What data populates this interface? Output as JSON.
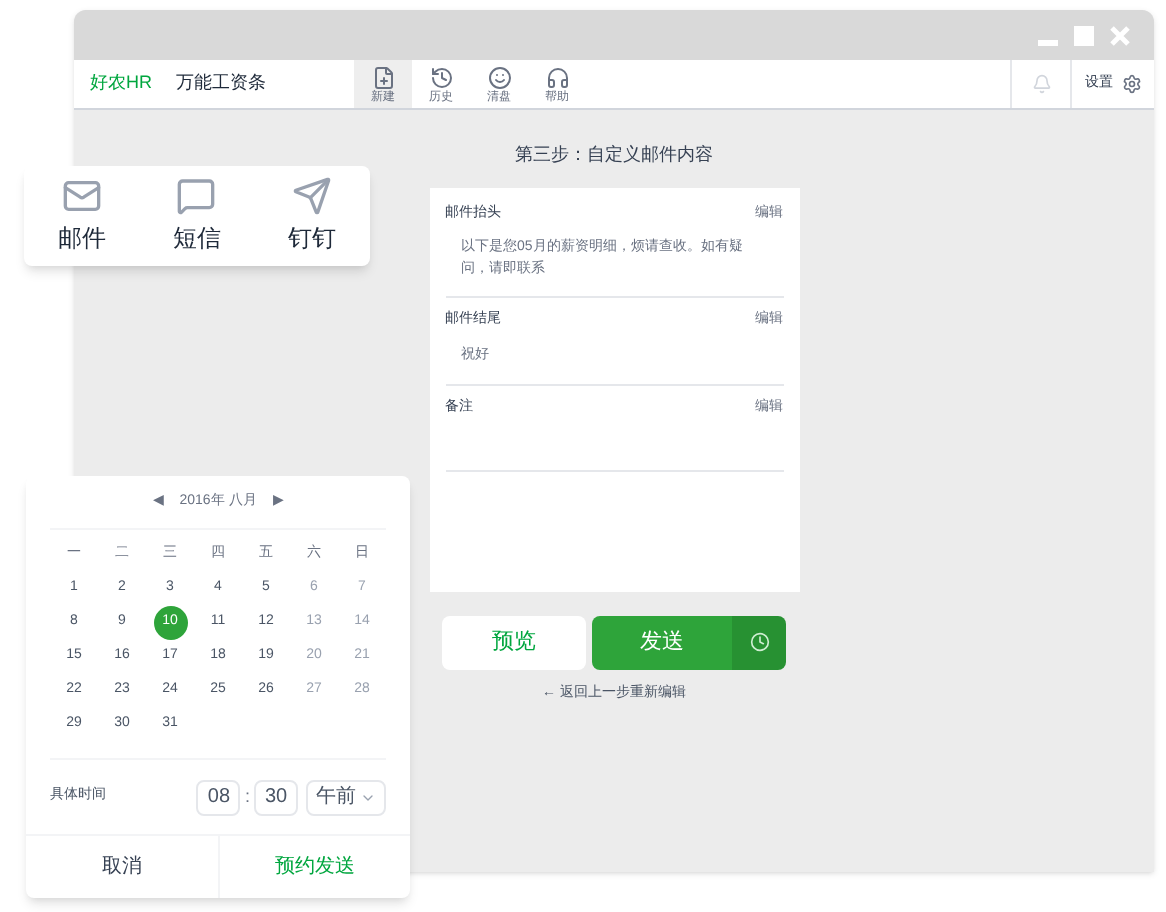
{
  "app": {
    "brand": "好农HR",
    "product": "万能工资条"
  },
  "toolbar": [
    {
      "label": "新建",
      "selected": true
    },
    {
      "label": "历史",
      "selected": false
    },
    {
      "label": "清盘",
      "selected": false
    },
    {
      "label": "帮助",
      "selected": false
    }
  ],
  "settings": {
    "label": "设置"
  },
  "step_title": "第三步：自定义邮件内容",
  "sections": [
    {
      "title": "邮件抬头",
      "action": "编辑",
      "body": "以下是您05月的薪资明细，烦请查收。如有疑问，请即联系"
    },
    {
      "title": "邮件结尾",
      "action": "编辑",
      "body": "祝好"
    },
    {
      "title": "备注",
      "action": "编辑"
    }
  ],
  "preview_button": "预览",
  "send_button": "发送",
  "back_link": "← 返回上一步重新编辑",
  "channels": [
    {
      "label": "邮件"
    },
    {
      "label": "短信"
    },
    {
      "label": "钉钉"
    }
  ],
  "calendar": {
    "prev": "◀",
    "month_label": "2016年 八月",
    "next": "▶",
    "weekdays": [
      "一",
      "二",
      "三",
      "四",
      "五",
      "六",
      "日"
    ],
    "days": [
      {
        "label": "1",
        "disabled": false,
        "selected": false
      },
      {
        "label": "2",
        "disabled": false,
        "selected": false
      },
      {
        "label": "3",
        "disabled": false,
        "selected": false
      },
      {
        "label": "4",
        "disabled": false,
        "selected": false
      },
      {
        "label": "5",
        "disabled": false,
        "selected": false
      },
      {
        "label": "6",
        "disabled": true,
        "selected": false
      },
      {
        "label": "7",
        "disabled": true,
        "selected": false
      },
      {
        "label": "8",
        "disabled": false,
        "selected": false
      },
      {
        "label": "9",
        "disabled": false,
        "selected": false
      },
      {
        "label": "10",
        "disabled": false,
        "selected": true
      },
      {
        "label": "11",
        "disabled": false,
        "selected": false
      },
      {
        "label": "12",
        "disabled": false,
        "selected": false
      },
      {
        "label": "13",
        "disabled": true,
        "selected": false
      },
      {
        "label": "14",
        "disabled": true,
        "selected": false
      },
      {
        "label": "15",
        "disabled": false,
        "selected": false
      },
      {
        "label": "16",
        "disabled": false,
        "selected": false
      },
      {
        "label": "17",
        "disabled": false,
        "selected": false
      },
      {
        "label": "18",
        "disabled": false,
        "selected": false
      },
      {
        "label": "19",
        "disabled": false,
        "selected": false
      },
      {
        "label": "20",
        "disabled": true,
        "selected": false
      },
      {
        "label": "21",
        "disabled": true,
        "selected": false
      },
      {
        "label": "22",
        "disabled": false,
        "selected": false
      },
      {
        "label": "23",
        "disabled": false,
        "selected": false
      },
      {
        "label": "24",
        "disabled": false,
        "selected": false
      },
      {
        "label": "25",
        "disabled": false,
        "selected": false
      },
      {
        "label": "26",
        "disabled": false,
        "selected": false
      },
      {
        "label": "27",
        "disabled": true,
        "selected": false
      },
      {
        "label": "28",
        "disabled": true,
        "selected": false
      },
      {
        "label": "29",
        "disabled": false,
        "selected": false
      },
      {
        "label": "30",
        "disabled": false,
        "selected": false
      },
      {
        "label": "31",
        "disabled": false,
        "selected": false
      }
    ],
    "time_label": "具体时间",
    "hour": "08",
    "separator": ":",
    "minute": "30",
    "period": "午前",
    "cancel_button": "取消",
    "schedule_button": "预约发送"
  }
}
